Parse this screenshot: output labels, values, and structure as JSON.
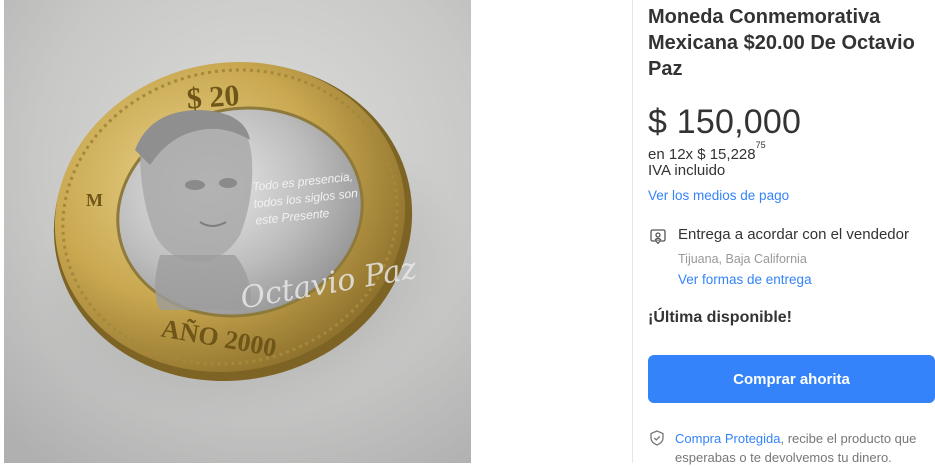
{
  "product": {
    "title": "Moneda Conmemorativa Mexicana $20.00 De Octavio Paz",
    "image_alt": "Moneda de 20 pesos de Octavio Paz, año 2000"
  },
  "coin": {
    "denomination": "$ 20",
    "year": "AÑO 2000",
    "quote_line1": "Todo es presencia,",
    "quote_line2": "todos los siglos son",
    "quote_line3": "este Presente",
    "signature": "Octavio Paz",
    "mint_mark": "M"
  },
  "price": {
    "amount": "$ 150,000",
    "installments_prefix": "en 12x $ 15,228",
    "installments_cents": "75",
    "tax_note": "IVA incluido",
    "payment_link": "Ver los medios de pago"
  },
  "delivery": {
    "text": "Entrega a acordar con el vendedor",
    "location": "Tijuana, Baja California",
    "link": "Ver formas de entrega"
  },
  "stock": {
    "label": "¡Última disponible!"
  },
  "actions": {
    "buy_label": "Comprar ahorita"
  },
  "protection": {
    "link": "Compra Protegida",
    "text": ", recibe el producto que esperabas o te devolvemos tu dinero."
  },
  "colors": {
    "accent": "#3483fa",
    "text": "#333333",
    "muted": "#999999"
  }
}
